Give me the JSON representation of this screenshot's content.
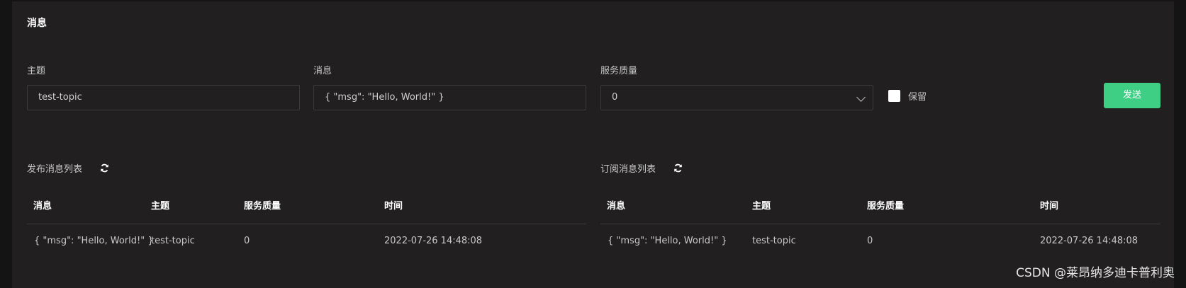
{
  "panel": {
    "title": "消息"
  },
  "form": {
    "topic_label": "主题",
    "topic_value": "test-topic",
    "message_label": "消息",
    "message_value": "{ \"msg\": \"Hello, World!\" }",
    "qos_label": "服务质量",
    "qos_value": "0",
    "retain_label": "保留",
    "retain_checked": false,
    "send_label": "发送"
  },
  "publish_list": {
    "title": "发布消息列表",
    "headers": [
      "消息",
      "主题",
      "服务质量",
      "时间"
    ],
    "rows": [
      [
        "{ \"msg\": \"Hello, World!\" }",
        "test-topic",
        "0",
        "2022-07-26 14:48:08"
      ]
    ]
  },
  "subscribe_list": {
    "title": "订阅消息列表",
    "headers": [
      "消息",
      "主题",
      "服务质量",
      "时间"
    ],
    "rows": [
      [
        "{ \"msg\": \"Hello, World!\" }",
        "test-topic",
        "0",
        "2022-07-26 14:48:08"
      ]
    ]
  },
  "watermark": "CSDN @莱昂纳多迪卡普利奥",
  "colors": {
    "background": "#141414",
    "card": "#211f20",
    "border": "#3b393a",
    "accent": "#3ecf84"
  },
  "icons": {
    "refresh": "refresh-icon",
    "dropdown": "chevron-down-icon"
  }
}
